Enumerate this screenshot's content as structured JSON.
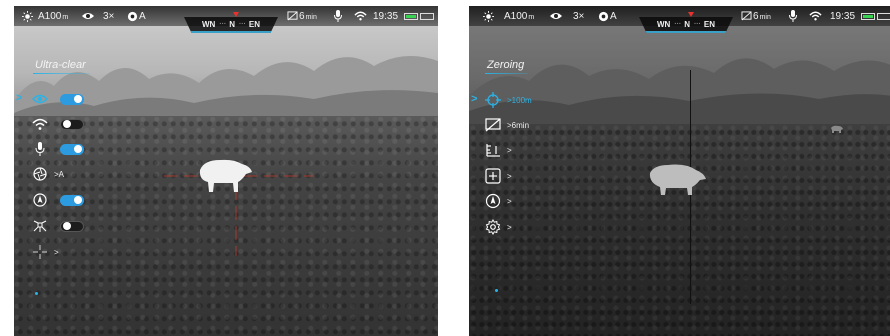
{
  "statusbar": {
    "range_value": "A100",
    "range_unit": "m",
    "zoom": "3×",
    "mode": "A",
    "shutdown_value": "6",
    "shutdown_unit": "min",
    "time": "19:35",
    "compass": {
      "left": "WN",
      "center": "N",
      "right": "EN"
    }
  },
  "left_screen": {
    "menu_title": "Ultra-clear",
    "rows": [
      {
        "icon": "eye-icon",
        "state": "on",
        "selected": true
      },
      {
        "icon": "wifi-icon",
        "state": "off"
      },
      {
        "icon": "microphone-icon",
        "state": "on"
      },
      {
        "icon": "aperture-icon",
        "value": ">A"
      },
      {
        "icon": "compass-icon",
        "state": "on"
      },
      {
        "icon": "gps-satellite-icon",
        "state": "off"
      },
      {
        "icon": "reticle-icon",
        "value": ">"
      }
    ]
  },
  "right_screen": {
    "menu_title": "Zeroing",
    "rows": [
      {
        "icon": "crosshair-target-icon",
        "value": ">100m",
        "selected": true
      },
      {
        "icon": "auto-shutdown-icon",
        "value": ">6min"
      },
      {
        "icon": "ruler-icon",
        "value": ">"
      },
      {
        "icon": "add-crosshair-icon",
        "value": ">"
      },
      {
        "icon": "compass-icon",
        "value": ">"
      },
      {
        "icon": "settings-gear-icon",
        "value": ">"
      }
    ]
  },
  "colors": {
    "accent": "#2ab3e6",
    "toggle_on": "#2c9be0",
    "compass_marker": "#e8322d",
    "battery": "#39d353",
    "reticle_left": "#c0392b"
  },
  "selector_glyph": ">"
}
